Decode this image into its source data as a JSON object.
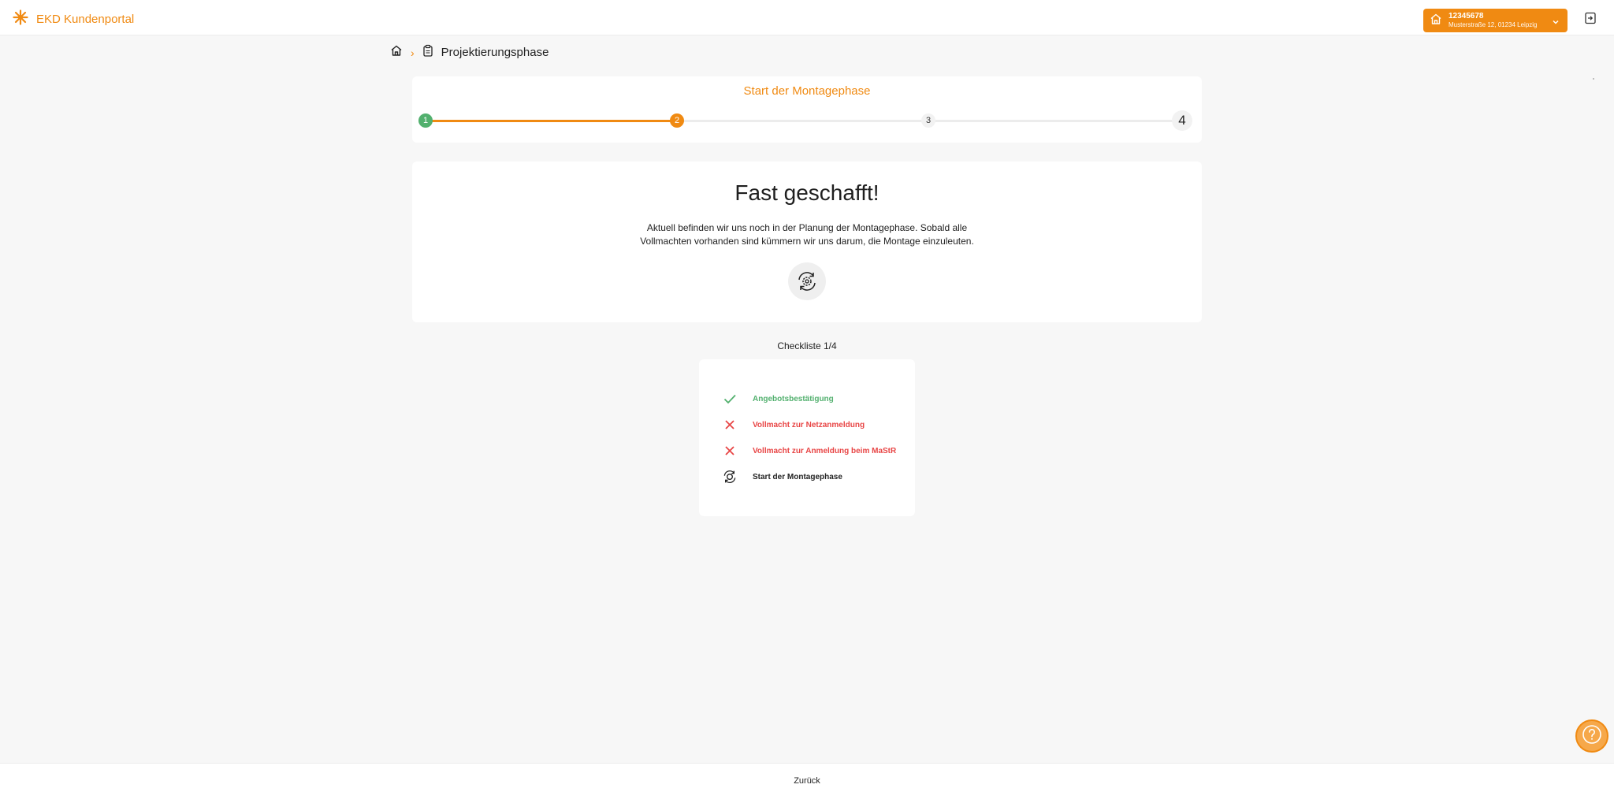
{
  "header": {
    "brand": "EKD Kundenportal",
    "account_number": "12345678",
    "account_address": "Musterstraße 12, 01234 Leipzig",
    "brand_color": "#f08a12"
  },
  "breadcrumb": {
    "page": "Projektierungsphase"
  },
  "stepper": {
    "title": "Start der Montagephase",
    "steps": [
      "1",
      "2",
      "3",
      "4"
    ],
    "current_step": 2,
    "completed_step": 1
  },
  "main": {
    "title": "Fast geschafft!",
    "text_line1": "Aktuell befinden wir uns noch in der Planung der Montagephase. Sobald alle",
    "text_line2": "Vollmachten vorhanden sind kümmern wir uns darum, die Montage einzuleuten."
  },
  "checklist": {
    "heading": "Checkliste 1/4",
    "items": [
      {
        "label": "Angebotsbestätigung",
        "status": "done"
      },
      {
        "label": "Vollmacht zur Netzanmeldung",
        "status": "missing"
      },
      {
        "label": "Vollmacht zur Anmeldung beim MaStR",
        "status": "missing"
      },
      {
        "label": "Start der Montagephase",
        "status": "in-progress"
      }
    ]
  },
  "footer": {
    "back_label": "Zurück"
  },
  "colors": {
    "accent": "#f08a12",
    "success": "#52b06e",
    "error": "#e84545"
  }
}
